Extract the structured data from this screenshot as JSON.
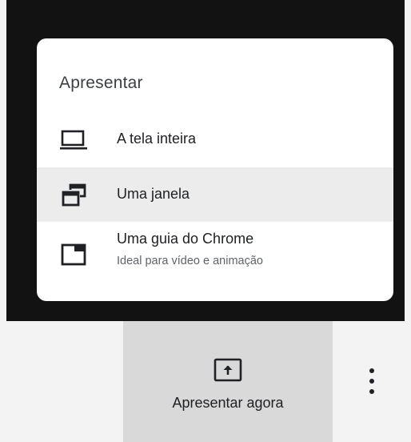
{
  "menu": {
    "title": "Apresentar",
    "items": [
      {
        "label": "A tela inteira",
        "icon": "monitor-icon"
      },
      {
        "label": "Uma janela",
        "icon": "window-icon",
        "highlighted": true
      },
      {
        "label": "Uma guia do Chrome",
        "sublabel": "Ideal para vídeo e animação",
        "icon": "chrome-tab-icon"
      }
    ]
  },
  "bottom_bar": {
    "present_now_label": "Apresentar agora",
    "present_icon": "present-upload-icon",
    "more_icon": "more-vertical-icon"
  },
  "colors": {
    "backdrop": "#121212",
    "menu_background": "#ffffff",
    "highlight": "#ececec",
    "button_background": "#d9d9d9",
    "secondary_text": "#5f6368"
  }
}
